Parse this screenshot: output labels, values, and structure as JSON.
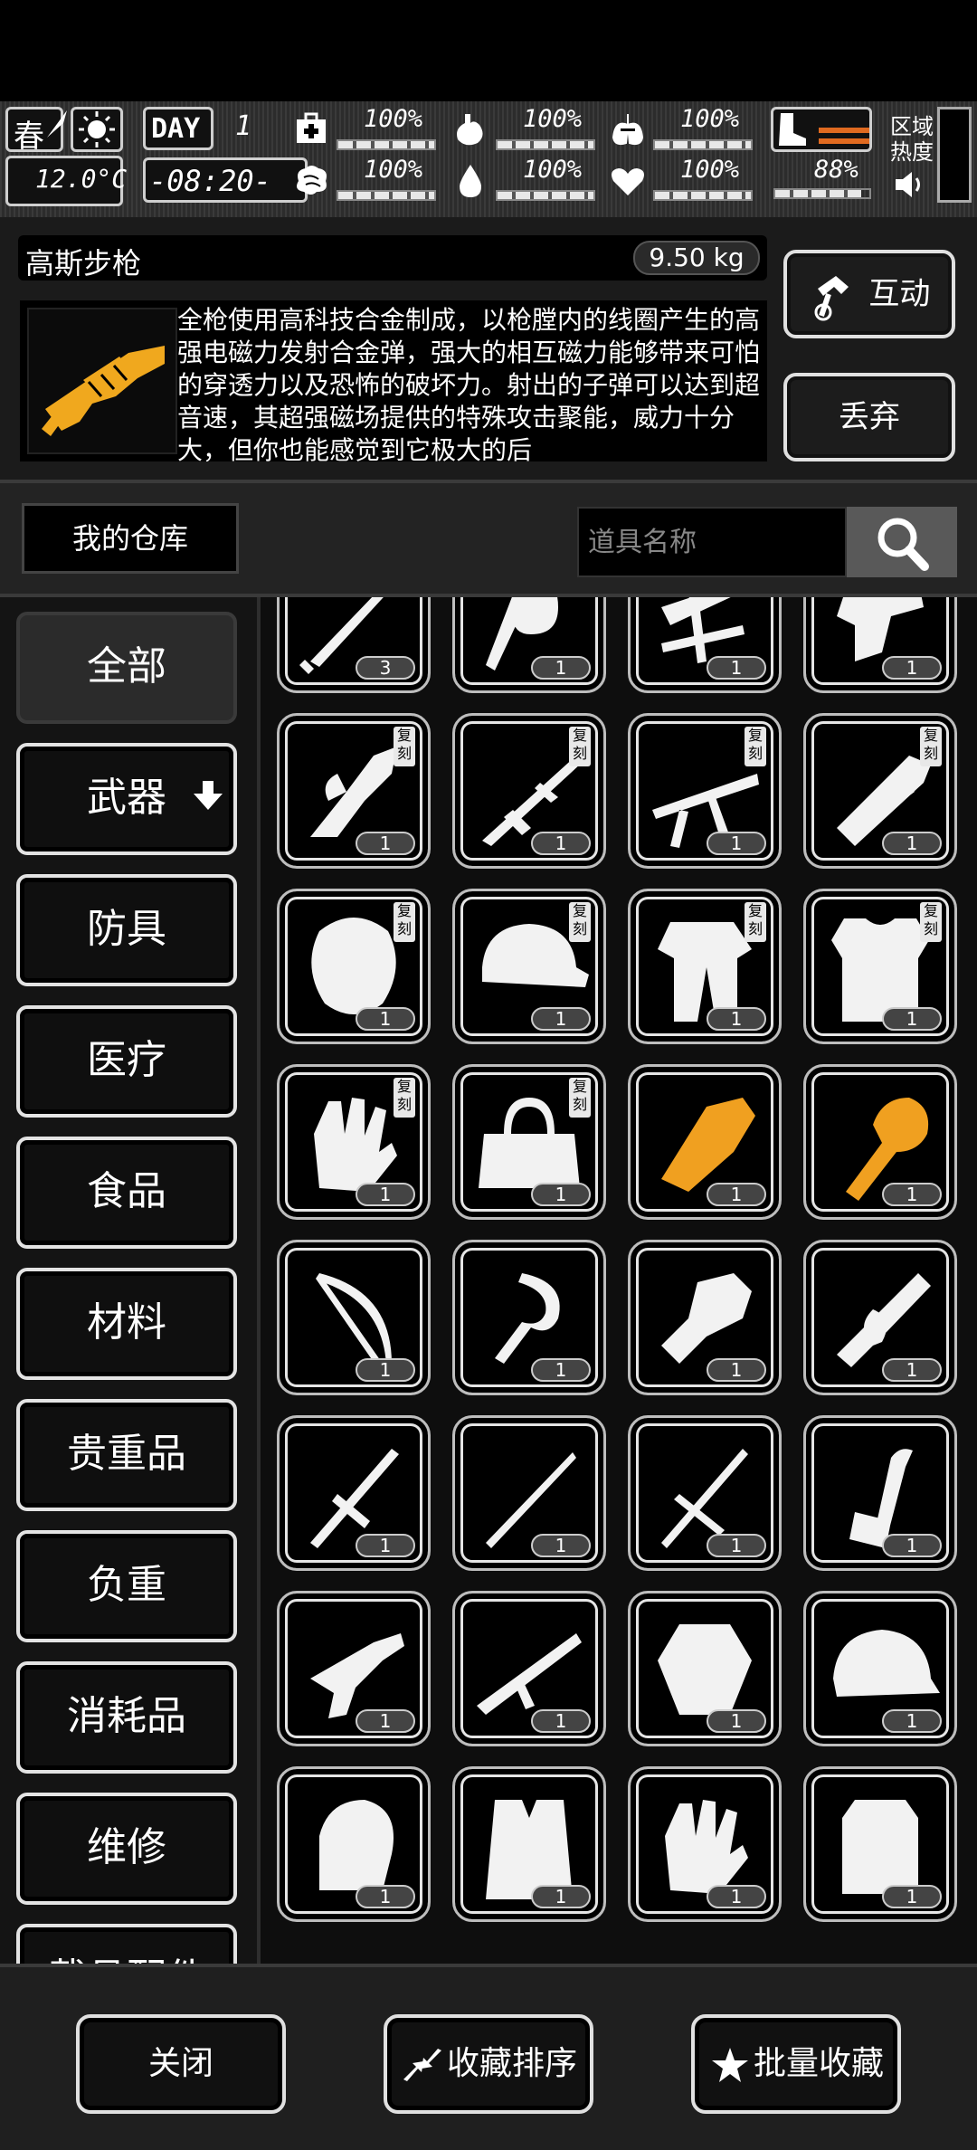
{
  "status": {
    "season": "春",
    "temperature": "12.0°C",
    "day_label": "DAY",
    "day_number": "1",
    "time": "-08:20-",
    "stats": [
      {
        "id": "health",
        "icon": "medkit-icon",
        "value": "100%",
        "level": 1.0
      },
      {
        "id": "hunger",
        "icon": "stomach-icon",
        "value": "100%",
        "level": 1.0
      },
      {
        "id": "stamina",
        "icon": "lung-icon",
        "value": "100%",
        "level": 1.0
      },
      {
        "id": "mind",
        "icon": "brain-icon",
        "value": "100%",
        "level": 1.0
      },
      {
        "id": "thirst",
        "icon": "water-drop-icon",
        "value": "100%",
        "level": 1.0
      },
      {
        "id": "mood",
        "icon": "heart-icon",
        "value": "100%",
        "level": 1.0
      }
    ],
    "load": {
      "icon": "boot-icon",
      "value": "88%",
      "level": 0.88
    },
    "zone_heat_label": "区域热度",
    "sound_icon": "speaker-icon"
  },
  "item": {
    "name": "高斯步枪",
    "weight": "9.50 kg",
    "description": "全枪使用高科技合金制成，以枪膛内的线圈产生的高强电磁力发射合金弹，强大的相互磁力能够带来可怕的穿透力以及恐怖的破坏力。射出的子弹可以达到超音速，其超强磁场提供的特殊攻击聚能，威力十分大，但你也能感觉到它极大的后",
    "thumb_color": "#f0a81e"
  },
  "actions": {
    "interact": "互动",
    "discard": "丢弃"
  },
  "repo": {
    "label": "我的仓库",
    "search_placeholder": "道具名称"
  },
  "categories": [
    "全部",
    "武器",
    "防具",
    "医疗",
    "食品",
    "材料",
    "贵重品",
    "负重",
    "消耗品",
    "维修",
    "载具配件"
  ],
  "badge_text": "复刻",
  "grid": [
    {
      "name": "sword",
      "count": "3",
      "badge": true
    },
    {
      "name": "whip",
      "count": "1",
      "badge": true
    },
    {
      "name": "crossbow",
      "count": "1",
      "badge": true
    },
    {
      "name": "pistol",
      "count": "1",
      "badge": true
    },
    {
      "name": "dragon-gun",
      "count": "1",
      "badge": true
    },
    {
      "name": "sniper-rifle",
      "count": "1",
      "badge": true
    },
    {
      "name": "machine-gun",
      "count": "1",
      "badge": true
    },
    {
      "name": "cannon",
      "count": "1",
      "badge": true
    },
    {
      "name": "gas-mask",
      "count": "1",
      "badge": true
    },
    {
      "name": "cap",
      "count": "1",
      "badge": true
    },
    {
      "name": "robe",
      "count": "1",
      "badge": true
    },
    {
      "name": "vest",
      "count": "1",
      "badge": true
    },
    {
      "name": "gloves",
      "count": "1",
      "badge": true
    },
    {
      "name": "bag",
      "count": "1",
      "badge": true
    },
    {
      "name": "gold-blade",
      "count": "1",
      "badge": false,
      "color": "#f0a020"
    },
    {
      "name": "gold-mace",
      "count": "1",
      "badge": false,
      "color": "#f0a020"
    },
    {
      "name": "bow",
      "count": "1",
      "badge": false
    },
    {
      "name": "chain-whip",
      "count": "1",
      "badge": false
    },
    {
      "name": "gauntlet",
      "count": "1",
      "badge": false
    },
    {
      "name": "chainsaw",
      "count": "1",
      "badge": false
    },
    {
      "name": "spear",
      "count": "1",
      "badge": false
    },
    {
      "name": "katana",
      "count": "1",
      "badge": false
    },
    {
      "name": "halberd",
      "count": "1",
      "badge": false
    },
    {
      "name": "lute-axe",
      "count": "1",
      "badge": false
    },
    {
      "name": "turret",
      "count": "1",
      "badge": false
    },
    {
      "name": "rifle",
      "count": "1",
      "badge": false
    },
    {
      "name": "armor-plate",
      "count": "1",
      "badge": false
    },
    {
      "name": "bull-cap",
      "count": "1",
      "badge": false
    },
    {
      "name": "horse-helm",
      "count": "1",
      "badge": false
    },
    {
      "name": "tactical-vest",
      "count": "1",
      "badge": false
    },
    {
      "name": "work-gloves",
      "count": "1",
      "badge": false
    },
    {
      "name": "backpack",
      "count": "1",
      "badge": false
    }
  ],
  "bottom": {
    "close": "关闭",
    "sort": "收藏排序",
    "batch": "批量收藏"
  }
}
